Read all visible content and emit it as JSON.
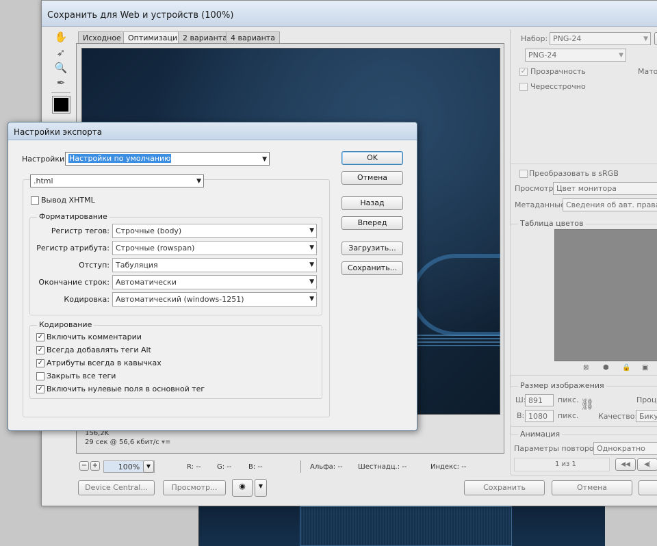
{
  "window": {
    "title": "Сохранить для Web и устройств (100%)",
    "tabs": [
      "Исходное",
      "Оптимизация",
      "2 варианта",
      "4 варианта"
    ],
    "active_tab": 1,
    "status": {
      "size": "156,2K",
      "time": "29 сек @ 56,6 кбит/с"
    },
    "zoom": "100%",
    "readouts": {
      "r": "R: --",
      "g": "G: --",
      "b": "B: --",
      "alpha": "Альфа: --",
      "hex": "Шестнадц.: --",
      "index": "Индекс: --"
    },
    "buttons": {
      "device_central": "Device Central...",
      "preview": "Просмотр...",
      "save": "Сохранить",
      "cancel": "Отмена"
    }
  },
  "right_panel": {
    "preset_label": "Набор:",
    "preset_value": "PNG-24",
    "format_value": "PNG-24",
    "transparency": "Прозрачность",
    "matte": "Матов",
    "interlaced": "Чересстрочно",
    "convert_srgb": "Преобразовать в sRGB",
    "preview_label": "Просмотр:",
    "preview_value": "Цвет монитора",
    "metadata_label": "Метаданные:",
    "metadata_value": "Сведения об авт. правах",
    "color_table_title": "Таблица цветов",
    "image_size_title": "Размер изображения",
    "width_label": "Ш:",
    "width_value": "891",
    "height_label": "В:",
    "height_value": "1080",
    "units": "пикс.",
    "percent_label": "Проце",
    "quality_label": "Качество:",
    "quality_value": "Бику",
    "animation_title": "Анимация",
    "loop_label": "Параметры повторов:",
    "loop_value": "Однократно",
    "frame_counter": "1 из 1"
  },
  "export_dialog": {
    "title": "Настройки экспорта",
    "settings_label": "Настройки:",
    "settings_value": "Настройки по умолчанию",
    "type_value": ".html",
    "xhtml_label": "Вывод XHTML",
    "formatting_title": "Форматирование",
    "format_rows": [
      {
        "label": "Регистр тегов:",
        "value": "Строчные (body)"
      },
      {
        "label": "Регистр атрибута:",
        "value": "Строчные (rowspan)"
      },
      {
        "label": "Отступ:",
        "value": "Табуляция"
      },
      {
        "label": "Окончание строк:",
        "value": "Автоматически"
      },
      {
        "label": "Кодировка:",
        "value": "Автоматический (windows-1251)"
      }
    ],
    "coding_title": "Кодирование",
    "coding_options": [
      {
        "label": "Включить комментарии",
        "checked": true,
        "mark": "✓"
      },
      {
        "label": "Всегда добавлять теги Alt",
        "checked": true,
        "mark": "✓"
      },
      {
        "label": "Атрибуты всегда в кавычках",
        "checked": true,
        "mark": "✓"
      },
      {
        "label": "Закрыть все теги",
        "checked": false,
        "mark": ""
      },
      {
        "label": "Включить нулевые поля в основной тег",
        "checked": true,
        "mark": "✓"
      }
    ],
    "buttons": {
      "ok": "OK",
      "cancel": "Отмена",
      "back": "Назад",
      "forward": "Вперед",
      "load": "Загрузить...",
      "save": "Сохранить..."
    }
  }
}
